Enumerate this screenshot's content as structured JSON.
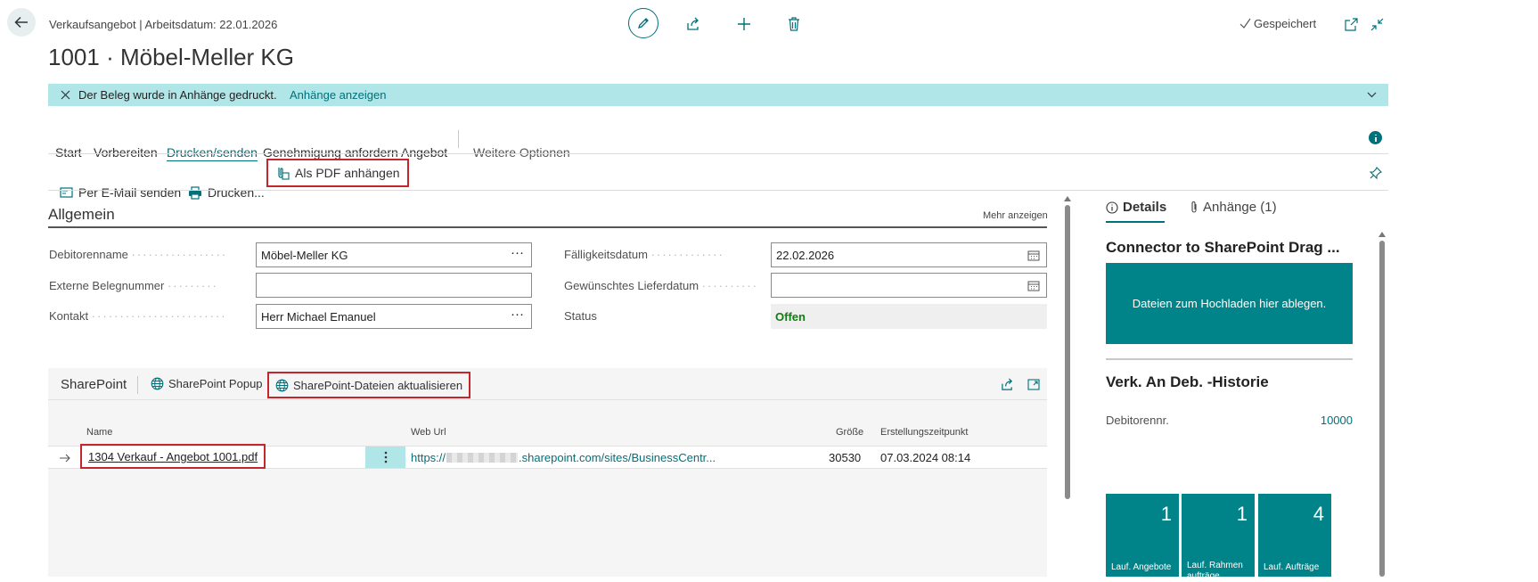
{
  "header": {
    "subtitle": "Verkaufsangebot | Arbeitsdatum: 22.01.2026",
    "title": "1001 · Möbel-Meller KG",
    "saved_label": "Gespeichert"
  },
  "banner": {
    "message": "Der Beleg wurde in Anhänge gedruckt.",
    "link": "Anhänge anzeigen"
  },
  "tabs": [
    {
      "label": "Start"
    },
    {
      "label": "Vorbereiten"
    },
    {
      "label": "Drucken/senden"
    },
    {
      "label": "Genehmigung anfordern"
    },
    {
      "label": "Angebot"
    },
    {
      "label": "Weitere Optionen"
    }
  ],
  "actions": {
    "email": "Per E-Mail senden",
    "print": "Drucken...",
    "pdf": "Als PDF anhängen"
  },
  "general": {
    "title": "Allgemein",
    "show_more": "Mehr anzeigen",
    "fields": {
      "customer_name_label": "Debitorenname",
      "customer_name_value": "Möbel-Meller KG",
      "ext_doc_label": "Externe Belegnummer",
      "ext_doc_value": "",
      "contact_label": "Kontakt",
      "contact_value": "Herr Michael Emanuel",
      "due_date_label": "Fälligkeitsdatum",
      "due_date_value": "22.02.2026",
      "req_delivery_label": "Gewünschtes Lieferdatum",
      "req_delivery_value": "",
      "status_label": "Status",
      "status_value": "Offen"
    }
  },
  "sharepoint": {
    "title": "SharePoint",
    "popup": "SharePoint Popup",
    "refresh": "SharePoint-Dateien aktualisieren",
    "columns": {
      "name": "Name",
      "url": "Web Url",
      "size": "Größe",
      "created": "Erstellungszeitpunkt"
    },
    "rows": [
      {
        "name": "1304 Verkauf - Angebot 1001.pdf",
        "url_prefix": "https://",
        "url_suffix": ".sharepoint.com/sites/BusinessCentr...",
        "size": "30530",
        "created": "07.03.2024 08:14"
      }
    ]
  },
  "factbox": {
    "tab_details": "Details",
    "tab_attachments": "Anhänge (1)",
    "connector_title": "Connector to SharePoint Drag ...",
    "drop_zone": "Dateien zum Hochladen hier ablegen.",
    "history_title": "Verk. An Deb. -Historie",
    "customer_no_label": "Debitorennr.",
    "customer_no_value": "10000",
    "tiles": [
      {
        "value": "1",
        "label": "Lauf. Angebote"
      },
      {
        "value": "1",
        "label": "Lauf. Rahmenaufträge"
      },
      {
        "value": "4",
        "label": "Lauf. Aufträge"
      }
    ]
  },
  "colors": {
    "accent": "#00707a",
    "banner_bg": "#b1e6e9",
    "tile_bg": "#008489",
    "highlight_border": "#c4262e",
    "status_green": "#107c10"
  }
}
